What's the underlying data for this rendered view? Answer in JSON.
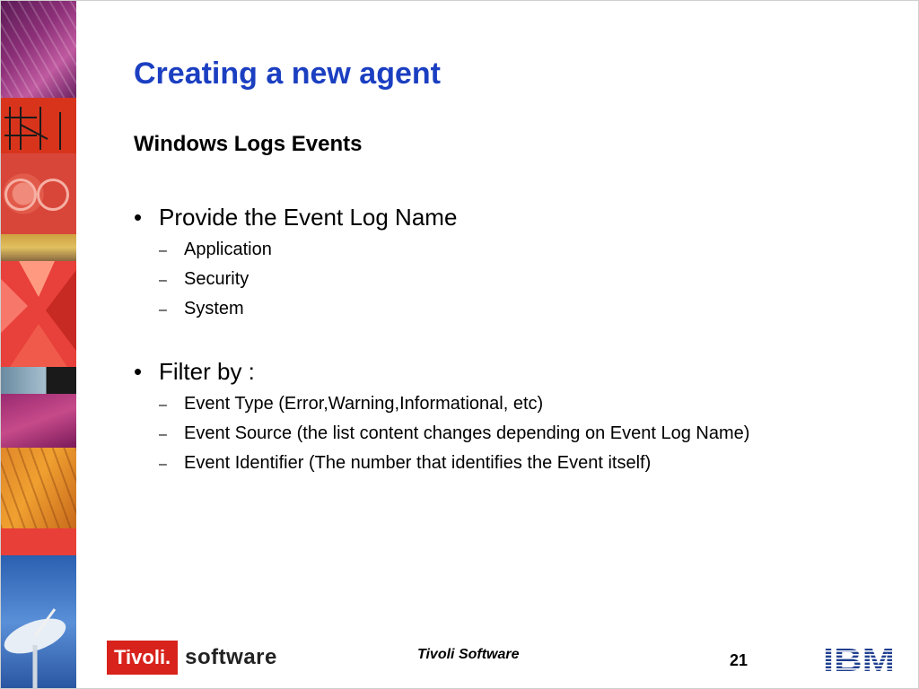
{
  "slide": {
    "title": "Creating a new agent",
    "subtitle": "Windows Logs Events",
    "bullets": [
      {
        "label": "Provide the Event Log Name",
        "items": [
          "Application",
          "Security",
          "System"
        ]
      },
      {
        "label": "Filter by :",
        "items": [
          "Event Type (Error,Warning,Informational, etc)",
          "Event Source (the list content changes depending on Event Log Name)",
          "Event Identifier (The number that identifies the Event itself)"
        ]
      }
    ],
    "bullet_glyph": "•",
    "dash_glyph": "–"
  },
  "footer": {
    "logo_brand": "Tivoli.",
    "logo_word": "software",
    "center_text": "Tivoli Software",
    "page_number": "21",
    "ibm_logo": "IBM"
  },
  "colors": {
    "title": "#1b3fc1",
    "tivoli_red": "#d8231c",
    "ibm_blue": "#1f3f8f"
  }
}
